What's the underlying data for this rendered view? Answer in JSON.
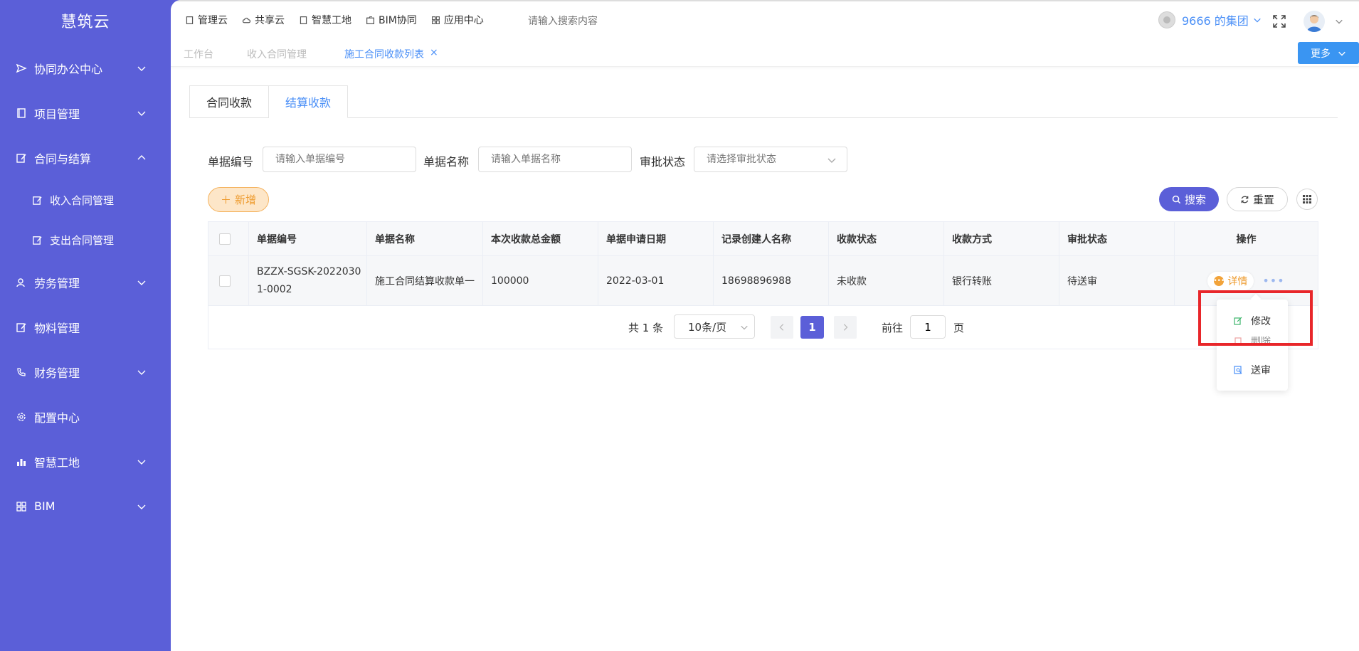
{
  "app": {
    "logo": "慧筑云"
  },
  "sidebar": {
    "items": [
      {
        "label": "协同办公中心",
        "icon": "send-icon"
      },
      {
        "label": "项目管理",
        "icon": "book-icon"
      },
      {
        "label": "合同与结算",
        "icon": "edit-icon",
        "expanded": true
      },
      {
        "label": "劳务管理",
        "icon": "user-group-icon"
      },
      {
        "label": "物料管理",
        "icon": "edit-icon"
      },
      {
        "label": "财务管理",
        "icon": "phone-icon"
      },
      {
        "label": "配置中心",
        "icon": "gear-icon"
      },
      {
        "label": "智慧工地",
        "icon": "bar-chart-icon"
      },
      {
        "label": "BIM",
        "icon": "grid-icon"
      }
    ],
    "subitems": [
      {
        "label": "收入合同管理"
      },
      {
        "label": "支出合同管理"
      }
    ]
  },
  "topnav": {
    "items": [
      {
        "label": "管理云"
      },
      {
        "label": "共享云"
      },
      {
        "label": "智慧工地"
      },
      {
        "label": "BIM协同"
      },
      {
        "label": "应用中心"
      }
    ],
    "search_placeholder": "请输入搜索内容",
    "org": "9666 的集团"
  },
  "page_tabs": {
    "items": [
      "工作台",
      "收入合同管理",
      "施工合同收款列表"
    ],
    "close": "×",
    "more": "更多"
  },
  "subtabs": [
    "合同收款",
    "结算收款"
  ],
  "filters": {
    "code_label": "单据编号",
    "code_placeholder": "请输入单据编号",
    "name_label": "单据名称",
    "name_placeholder": "请输入单据名称",
    "status_label": "审批状态",
    "status_placeholder": "请选择审批状态"
  },
  "toolbar": {
    "add": "新增",
    "search": "搜索",
    "reset": "重置"
  },
  "table": {
    "columns": [
      "单据编号",
      "单据名称",
      "本次收款总金额",
      "单据申请日期",
      "记录创建人名称",
      "收款状态",
      "收款方式",
      "审批状态",
      "操作"
    ],
    "rows": [
      {
        "code_line1": "BZZX-SGSK-2022030",
        "code_line2": "1-0002",
        "name": "施工合同结算收款单一",
        "amount": "100000",
        "date": "2022-03-01",
        "creator": "18698896988",
        "pay_status": "未收款",
        "pay_method": "银行转账",
        "approval": "待送审",
        "detail": "详情",
        "more": "•••"
      }
    ]
  },
  "pagination": {
    "total": "共 1 条",
    "page_size": "10条/页",
    "current": "1",
    "goto_label": "前往",
    "goto_value": "1",
    "page_suffix": "页"
  },
  "dropdown": {
    "edit": "修改",
    "delete": "删除",
    "submit": "送审"
  },
  "colors": {
    "sidebar": "#5b5fd8",
    "accent": "#4a8ff7",
    "primary_button": "#5b5fd8",
    "add_button": "#fde6c8",
    "highlight_box": "#e8262a"
  }
}
